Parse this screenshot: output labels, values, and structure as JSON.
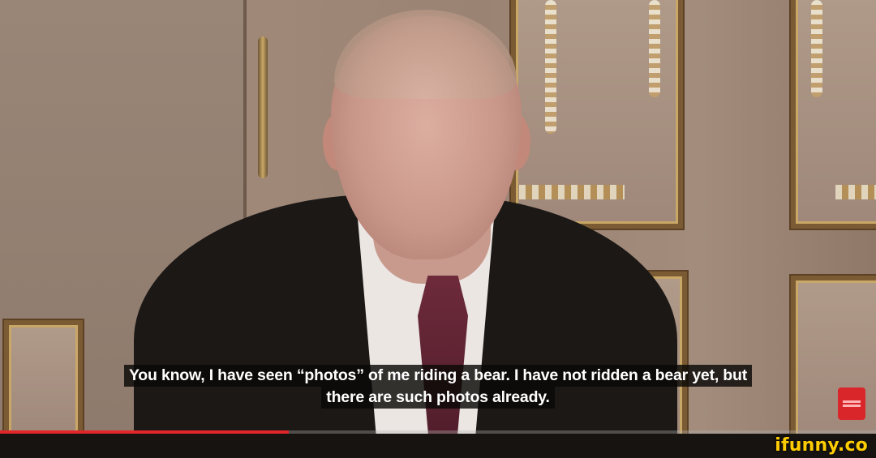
{
  "subtitle": {
    "line1": "You know, I have seen “photos” of me riding a bear. I have not ridden a bear yet, but",
    "line2": "there are such photos already."
  },
  "video": {
    "progress_fraction": 0.33,
    "progress_color": "#e2262a"
  },
  "watermark": {
    "text": "ifunny.co",
    "color": "#ffcc00"
  },
  "colors": {
    "wall": "#a08979",
    "gold": "#c9a766",
    "suit": "#1b1816",
    "tie": "#6d2a3a"
  }
}
